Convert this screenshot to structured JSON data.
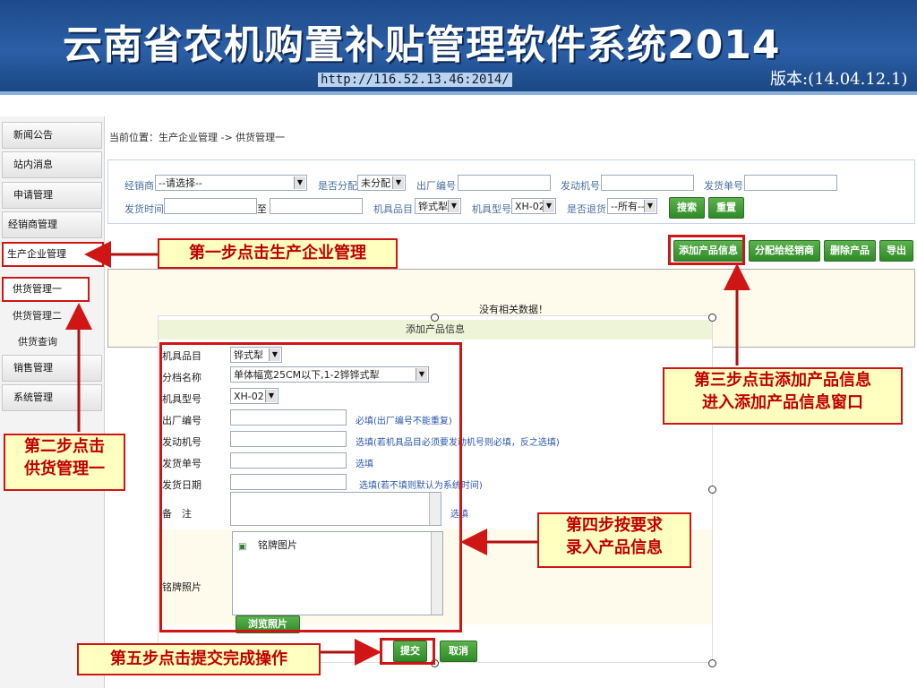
{
  "header": {
    "title": "云南省农机购置补贴管理软件系统2014",
    "url": "http://116.52.13.46:2014/",
    "version": "版本:(14.04.12.1)"
  },
  "sidebar": {
    "items": [
      "新闻公告",
      "站内消息",
      "申请管理",
      "经销商管理",
      "生产企业管理"
    ],
    "sub_items": [
      "供货管理一",
      "供货管理二",
      "供货查询"
    ],
    "items2": [
      "销售管理",
      "系统管理"
    ]
  },
  "breadcrumb": "当前位置：生产企业管理 -> 供货管理一",
  "filter": {
    "dealer_label": "经销商",
    "dealer_value": "--请选择--",
    "assigned_label": "是否分配",
    "assigned_value": "未分配",
    "factory_no_label": "出厂编号",
    "engine_no_label": "发动机号",
    "ship_no_label": "发货单号",
    "ship_time_label": "发货时间",
    "to_label": "至",
    "category_label": "机具品目",
    "category_value": "铧式犁",
    "model_label": "机具型号",
    "model_value": "XH-02",
    "returned_label": "是否退货",
    "returned_value": "--所有--",
    "search_button": "搜索",
    "reset_button": "重置"
  },
  "toolbar": {
    "add_button": "添加产品信息",
    "assign_button": "分配给经销商",
    "delete_button": "删除产品",
    "export_button": "导出"
  },
  "empty_message": "没有相关数据！",
  "dialog": {
    "title": "添加产品信息",
    "category_label": "机具品目",
    "category_value": "铧式犁",
    "class_label": "分档名称",
    "class_value": "单体幅宽25CM以下,1-2铧铧式犁",
    "model_label": "机具型号",
    "model_value": "XH-02",
    "factory_no_label": "出厂编号",
    "factory_no_hint": "必填(出厂编号不能重复)",
    "engine_no_label": "发动机号",
    "engine_no_hint": "选填(若机具品目必须要发动机号则必填，反之选填)",
    "ship_no_label": "发货单号",
    "ship_no_hint": "选填",
    "ship_date_label": "发货日期",
    "ship_date_hint": "选填(若不填则默认为系统时间)",
    "note_label": "备　注",
    "note_hint": "选填",
    "photo_label": "铭牌照片",
    "photo_item": "铭牌图片",
    "browse_button": "浏览照片",
    "submit_button": "提交",
    "cancel_button": "取消"
  },
  "annotations": {
    "step1": "第一步点击生产企业管理",
    "step2_line1": "第二步点击",
    "step2_line2": "供货管理一",
    "step3_line1": "第三步点击添加产品信息",
    "step3_line2": "进入添加产品信息窗口",
    "step4_line1": "第四步按要求",
    "step4_line2": "录入产品信息",
    "step5": "第五步点击提交完成操作"
  }
}
